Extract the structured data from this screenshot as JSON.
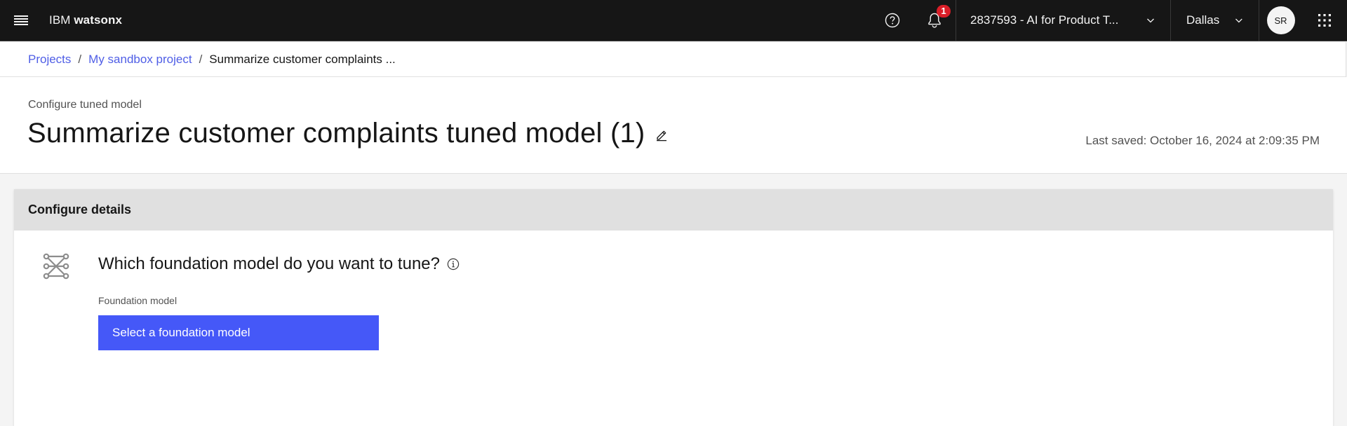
{
  "topbar": {
    "brand_prefix": "IBM",
    "brand_name": "watsonx",
    "notifications_count": "1",
    "account_label": "2837593 - AI for Product T...",
    "region_label": "Dallas",
    "avatar_initials": "SR",
    "icons": {
      "menu": "hamburger-menu-icon",
      "help": "help-icon",
      "notifications": "bell-icon",
      "apps": "app-switcher-icon"
    }
  },
  "breadcrumb": [
    {
      "label": "Projects"
    },
    {
      "label": "My sandbox project"
    },
    {
      "label": "Summarize customer complaints ..."
    }
  ],
  "breadcrumb_separator": "/",
  "header": {
    "eyebrow": "Configure tuned model",
    "title": "Summarize customer complaints tuned model (1)",
    "last_saved": "Last saved: October 16, 2024 at 2:09:35 PM"
  },
  "card": {
    "heading": "Configure details",
    "question": "Which foundation model do you want to tune?",
    "field_label": "Foundation model",
    "select_button": "Select a foundation model"
  },
  "colors": {
    "topbar_bg": "#161616",
    "link": "#4f5ee6",
    "primary_button": "#4558f8",
    "badge": "#da1e28",
    "card_header": "#e0e0e0"
  }
}
